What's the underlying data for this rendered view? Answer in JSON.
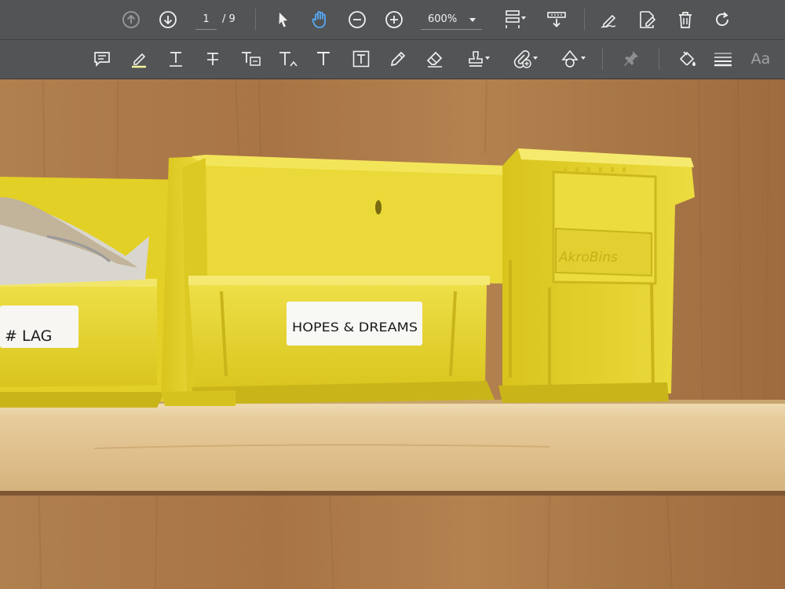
{
  "nav": {
    "current_page": "1",
    "total_pages": "/ 9",
    "zoom": "600%"
  },
  "toolbar_row1": {
    "icons": [
      "page-up-icon",
      "page-down-icon",
      "select-pointer-icon",
      "hand-tool-icon",
      "zoom-out-icon",
      "zoom-in-icon",
      "page-layout-icon",
      "scroll-mode-icon",
      "sign-icon",
      "edit-pdf-icon",
      "delete-icon",
      "rotate-icon"
    ]
  },
  "toolbar_row2": {
    "icons": [
      "comment-icon",
      "highlight-icon",
      "underline-icon",
      "strikethrough-icon",
      "replace-text-icon",
      "insert-text-icon",
      "add-text-icon",
      "text-box-icon",
      "pencil-icon",
      "eraser-icon",
      "stamp-icon",
      "attach-icon",
      "shapes-icon",
      "pin-icon",
      "fill-color-icon",
      "line-weight-icon",
      "font-size-icon"
    ],
    "font_button": "Aa"
  },
  "photo": {
    "label_left": "# LAG",
    "label_right": "HOPES & DREAMS",
    "bin_emboss": "AkroBins"
  },
  "colors": {
    "toolbar": "#525456",
    "icon": "#f0f0f0",
    "hand_active": "#56a8f5",
    "bin_yellow": "#e8d629",
    "wall_wood": "#a8784a",
    "shelf": "#e3c99c"
  }
}
